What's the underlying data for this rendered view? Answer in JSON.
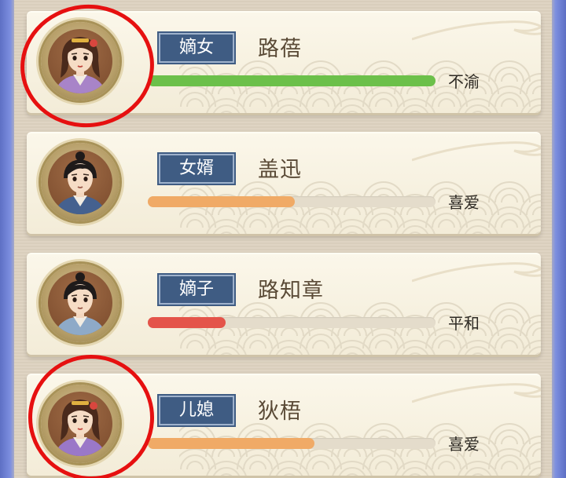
{
  "relatives": [
    {
      "relation": "嫡女",
      "name": "路蓓",
      "mood": "不渝",
      "favor": 1.0,
      "bar_color": "#6cc04a",
      "gender": "female",
      "robe_color": "#a884c8",
      "highlighted": true
    },
    {
      "relation": "女婿",
      "name": "盖迅",
      "mood": "喜爱",
      "favor": 0.51,
      "bar_color": "#f0aa66",
      "gender": "male",
      "robe_color": "#45618f",
      "highlighted": false
    },
    {
      "relation": "嫡子",
      "name": "路知章",
      "mood": "平和",
      "favor": 0.27,
      "bar_color": "#e4544a",
      "gender": "male",
      "robe_color": "#8eaac8",
      "highlighted": false
    },
    {
      "relation": "儿媳",
      "name": "狄梧",
      "mood": "喜爱",
      "favor": 0.58,
      "bar_color": "#f0aa66",
      "gender": "female",
      "robe_color": "#9a78c8",
      "highlighted": true
    }
  ],
  "colors": {
    "annotation_circle": "#e61010",
    "tag_bg": "#3f5c83",
    "name_text": "#5a4a36"
  }
}
